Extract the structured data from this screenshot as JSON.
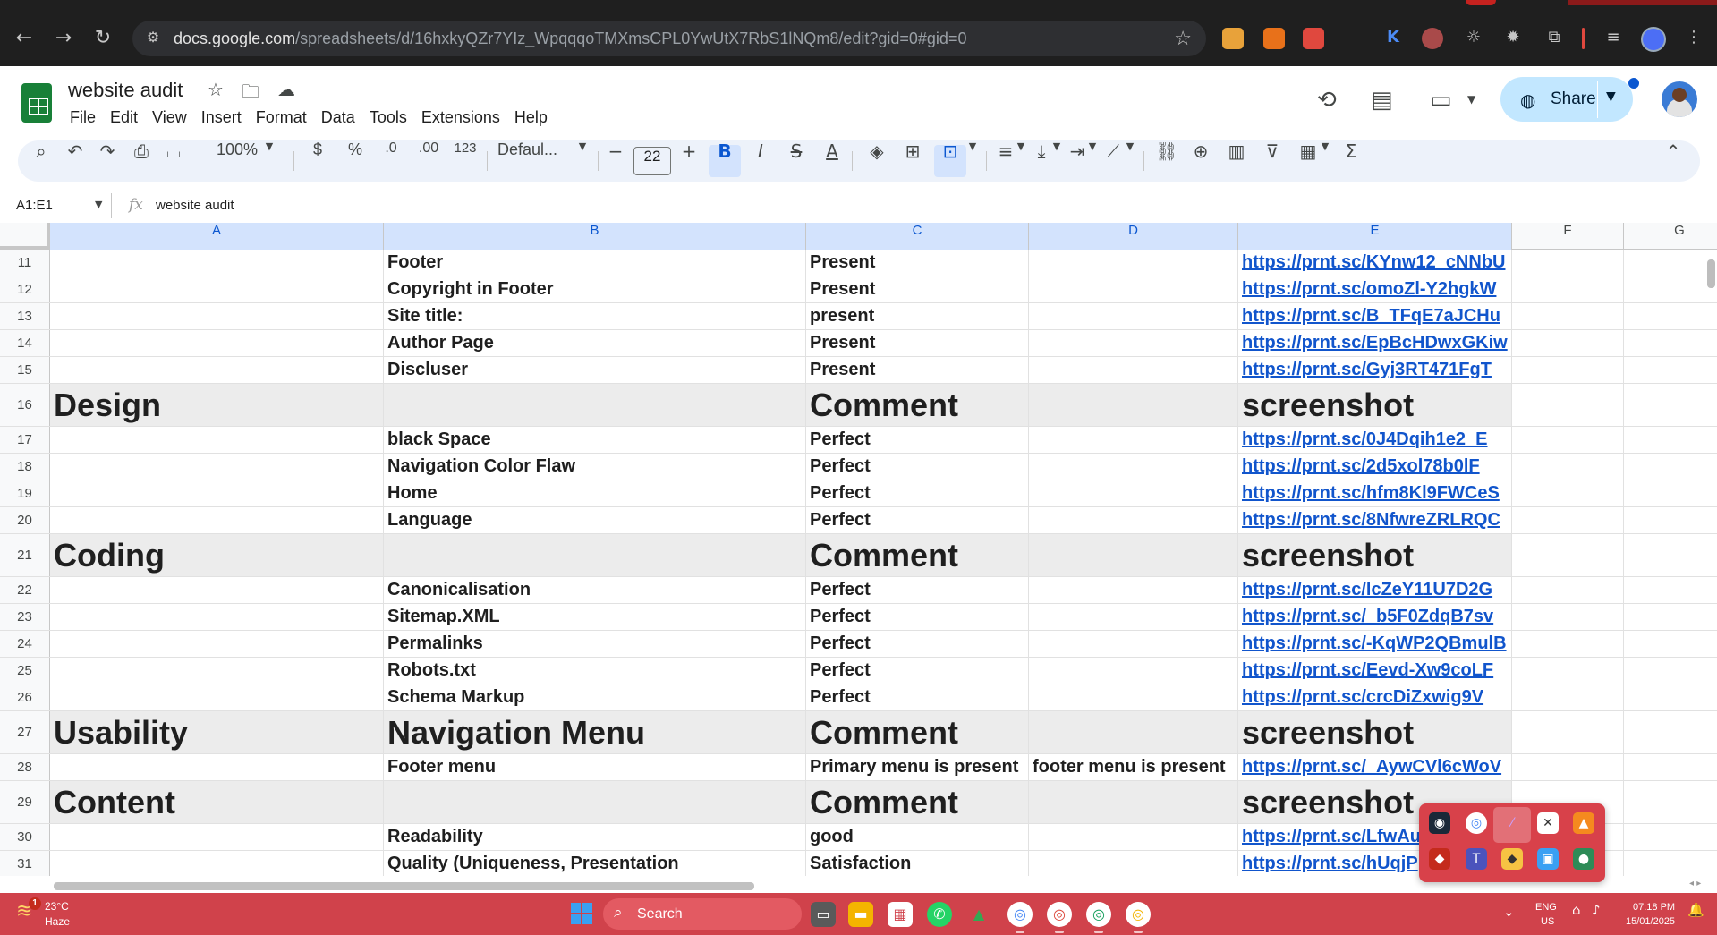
{
  "browser": {
    "url_host": "docs.google.com",
    "url_path": "/spreadsheets/d/16hxkyQZr7YIz_WpqqqoTMXmsCPL0YwUtX7RbS1lNQm8/edit?gid=0#gid=0"
  },
  "doc": {
    "title": "website audit",
    "menu": [
      "File",
      "Edit",
      "View",
      "Insert",
      "Format",
      "Data",
      "Tools",
      "Extensions",
      "Help"
    ],
    "share_label": "Share"
  },
  "toolbar": {
    "zoom": "100%",
    "currency": "$",
    "percent": "%",
    "dec_decrease": ".0",
    "dec_increase": ".00",
    "number_format": "123",
    "font": "Defaul...",
    "font_size": "22"
  },
  "formula_bar": {
    "name_box": "A1:E1",
    "fx": "fx",
    "content": "website audit"
  },
  "columns": [
    "A",
    "B",
    "C",
    "D",
    "E",
    "F",
    "G"
  ],
  "rows": [
    {
      "num": "11",
      "a": "",
      "b": "Footer",
      "c": "Present",
      "d": "",
      "e": "https://prnt.sc/KYnw12_cNNbU"
    },
    {
      "num": "12",
      "a": "",
      "b": "Copyright in Footer",
      "c": "Present",
      "d": "",
      "e": "https://prnt.sc/omoZl-Y2hgkW"
    },
    {
      "num": "13",
      "a": "",
      "b": "Site title:",
      "c": "present",
      "d": "",
      "e": "https://prnt.sc/B_TFqE7aJCHu"
    },
    {
      "num": "14",
      "a": "",
      "b": "Author Page",
      "c": "Present",
      "d": "",
      "e": "https://prnt.sc/EpBcHDwxGKiw"
    },
    {
      "num": "15",
      "a": "",
      "b": "Discluser",
      "c": "Present",
      "d": "",
      "e": "https://prnt.sc/Gyj3RT471FgT"
    },
    {
      "num": "16",
      "section": true,
      "a": "Design",
      "b": "",
      "c": "Comment",
      "d": "",
      "e": "screenshot"
    },
    {
      "num": "17",
      "a": "",
      "b": "black Space",
      "c": "Perfect",
      "d": "",
      "e": "https://prnt.sc/0J4Dqih1e2_E"
    },
    {
      "num": "18",
      "a": "",
      "b": "Navigation Color Flaw",
      "c": "Perfect",
      "d": "",
      "e": "https://prnt.sc/2d5xol78b0lF"
    },
    {
      "num": "19",
      "a": "",
      "b": "Home",
      "c": "Perfect",
      "d": "",
      "e": "https://prnt.sc/hfm8Kl9FWCeS"
    },
    {
      "num": "20",
      "a": "",
      "b": "Language",
      "c": "Perfect",
      "d": "",
      "e": "https://prnt.sc/8NfwreZRLRQC"
    },
    {
      "num": "21",
      "section": true,
      "a": "Coding",
      "b": "",
      "c": "Comment",
      "d": "",
      "e": "screenshot"
    },
    {
      "num": "22",
      "a": "",
      "b": "Canonicalisation",
      "c": "Perfect",
      "d": "",
      "e": "https://prnt.sc/lcZeY11U7D2G"
    },
    {
      "num": "23",
      "a": "",
      "b": "Sitemap.XML",
      "c": "Perfect",
      "d": "",
      "e": "https://prnt.sc/_b5F0ZdqB7sv"
    },
    {
      "num": "24",
      "a": "",
      "b": "Permalinks",
      "c": "Perfect",
      "d": "",
      "e": "https://prnt.sc/-KqWP2QBmulB"
    },
    {
      "num": "25",
      "a": "",
      "b": "Robots.txt",
      "c": "Perfect",
      "d": "",
      "e": "https://prnt.sc/Eevd-Xw9coLF"
    },
    {
      "num": "26",
      "a": "",
      "b": "Schema Markup",
      "c": "Perfect",
      "d": "",
      "e": "https://prnt.sc/crcDiZxwig9V"
    },
    {
      "num": "27",
      "section": true,
      "a": "Usability",
      "b": "Navigation Menu",
      "c": "Comment",
      "d": "",
      "e": "screenshot"
    },
    {
      "num": "28",
      "a": "",
      "b": "Footer menu",
      "c": "Primary menu is present",
      "d": "footer menu is present",
      "e": "https://prnt.sc/_AywCVl6cWoV"
    },
    {
      "num": "29",
      "section": true,
      "a": "Content",
      "b": "",
      "c": "Comment",
      "d": "",
      "e": "screenshot"
    },
    {
      "num": "30",
      "a": "",
      "b": "Readability",
      "c": "good",
      "d": "",
      "e": "https://prnt.sc/LfwAu"
    },
    {
      "num": "31",
      "a": "",
      "b": "Quality (Uniqueness, Presentation",
      "c": "Satisfaction",
      "d": "",
      "e": "https://prnt.sc/hUqjP"
    }
  ],
  "taskbar": {
    "temp": "23°C",
    "condition": "Haze",
    "weather_badge": "1",
    "search_label": "Search",
    "lang1": "ENG",
    "lang2": "US",
    "time": "07:18 PM",
    "date": "15/01/2025"
  },
  "colors": {
    "link": "#1155cc",
    "section_bg": "#ececec",
    "share_bg": "#c2e7ff",
    "taskbar": "#d0424b",
    "selected_header": "#d3e3fd"
  }
}
